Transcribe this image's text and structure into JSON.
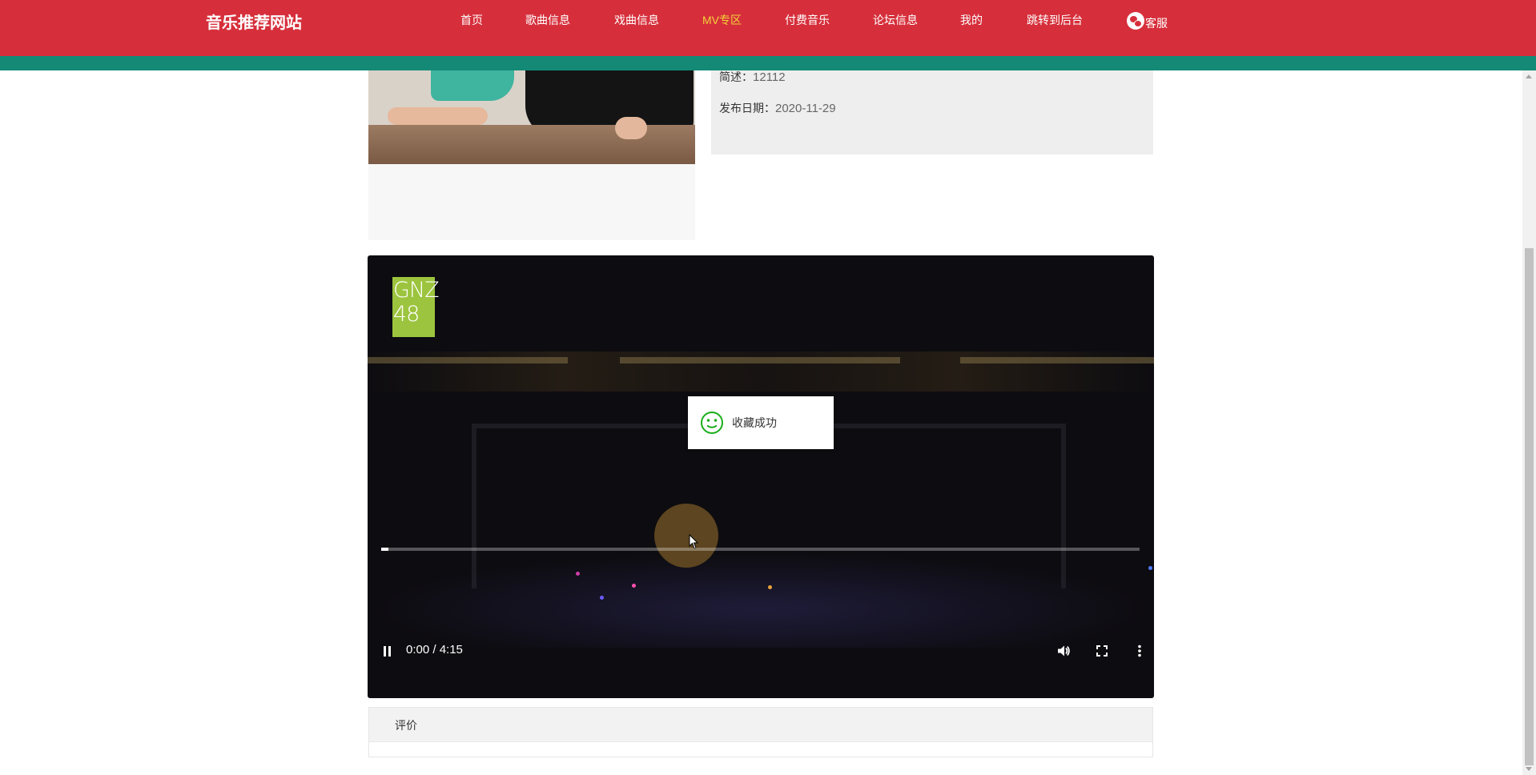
{
  "header": {
    "brand": "音乐推荐网站",
    "nav": [
      {
        "label": "首页",
        "active": false
      },
      {
        "label": "歌曲信息",
        "active": false
      },
      {
        "label": "戏曲信息",
        "active": false
      },
      {
        "label": "MV专区",
        "active": true
      },
      {
        "label": "付费音乐",
        "active": false
      },
      {
        "label": "论坛信息",
        "active": false
      },
      {
        "label": "我的",
        "active": false
      },
      {
        "label": "跳转到后台",
        "active": false
      }
    ],
    "service_label": "客服",
    "service_icon": "wechat-icon"
  },
  "info": {
    "desc_label": "简述：",
    "desc_value": "12112",
    "date_label": "发布日期：",
    "date_value": "2020-11-29"
  },
  "video": {
    "logo_line1": "GNZ",
    "logo_line2": "48",
    "time": "0:00 / 4:15",
    "progress": 0.01,
    "controls": [
      "pause-icon",
      "volume-icon",
      "fullscreen-icon",
      "more-icon"
    ]
  },
  "toast": {
    "text": "收藏成功",
    "icon": "smile-icon"
  },
  "comments": {
    "title": "评价"
  },
  "colors": {
    "header": "#d62f3b",
    "strip": "#148a76",
    "active_nav": "#f2d138",
    "toast_icon": "#1aad19"
  }
}
